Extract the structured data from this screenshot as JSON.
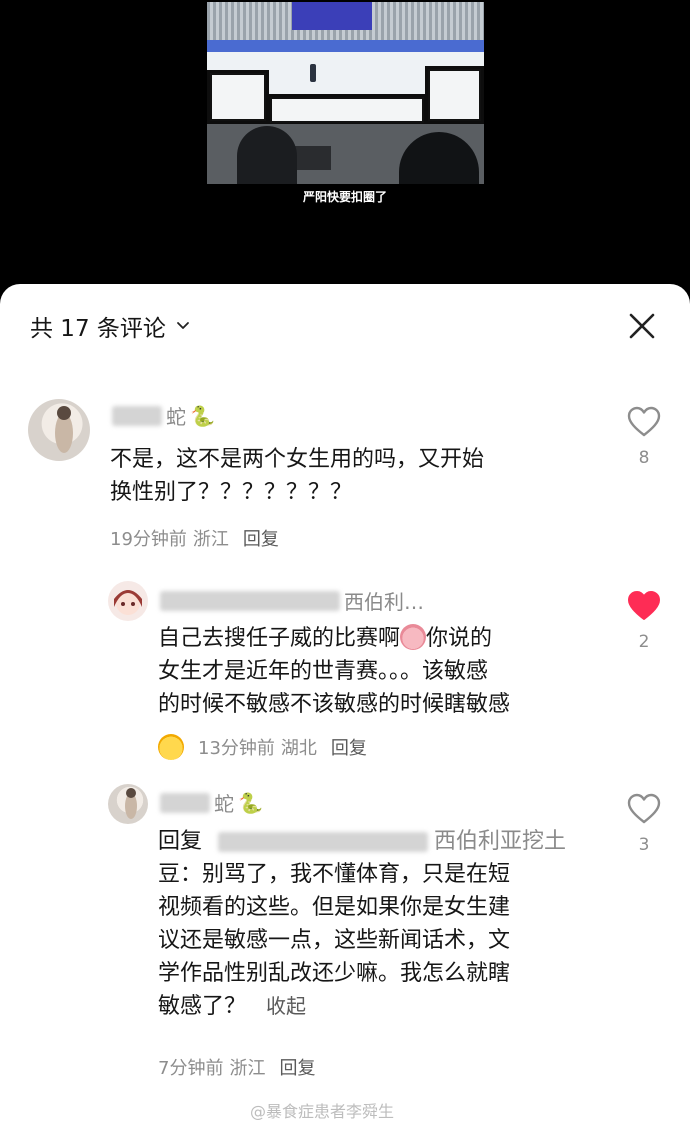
{
  "video": {
    "subtitle": "严阳快要扣圈了"
  },
  "sheet": {
    "title": "共 17 条评论"
  },
  "comments": [
    {
      "name_suffix": "蛇",
      "text_lines": [
        "不是，这不是两个女生用的吗，又开始",
        "换性别了？？？？？？？"
      ],
      "time": "19分钟前",
      "location": "浙江",
      "reply_label": "回复",
      "likes": "8",
      "liked": false
    },
    {
      "name_suffix": "西伯利…",
      "text_lines": [
        "自己去搜任子威的比赛啊",
        "你说的",
        "女生才是近年的世青赛。。。该敏感",
        "的时候不敏感不该敏感的时候瞎敏感"
      ],
      "time": "13分钟前",
      "location": "湖北",
      "reply_label": "回复",
      "likes": "2",
      "liked": true
    },
    {
      "name_suffix": "蛇",
      "reply_prefix": "回复",
      "reply_target": "西伯利亚挖土",
      "text_lines": [
        "豆：别骂了，我不懂体育，只是在短",
        "视频看的这些。但是如果你是女生建",
        "议还是敏感一点，这些新闻话术，文",
        "学作品性别乱改还少嘛。我怎么就瞎",
        "敏感了？"
      ],
      "collapse_label": "收起",
      "time": "7分钟前",
      "location": "浙江",
      "reply_label": "回复",
      "likes": "3",
      "liked": false
    }
  ],
  "watermark": "@暴食症患者李舜生",
  "colors": {
    "like_active": "#fe2c55",
    "muted": "#8d8d8d"
  }
}
